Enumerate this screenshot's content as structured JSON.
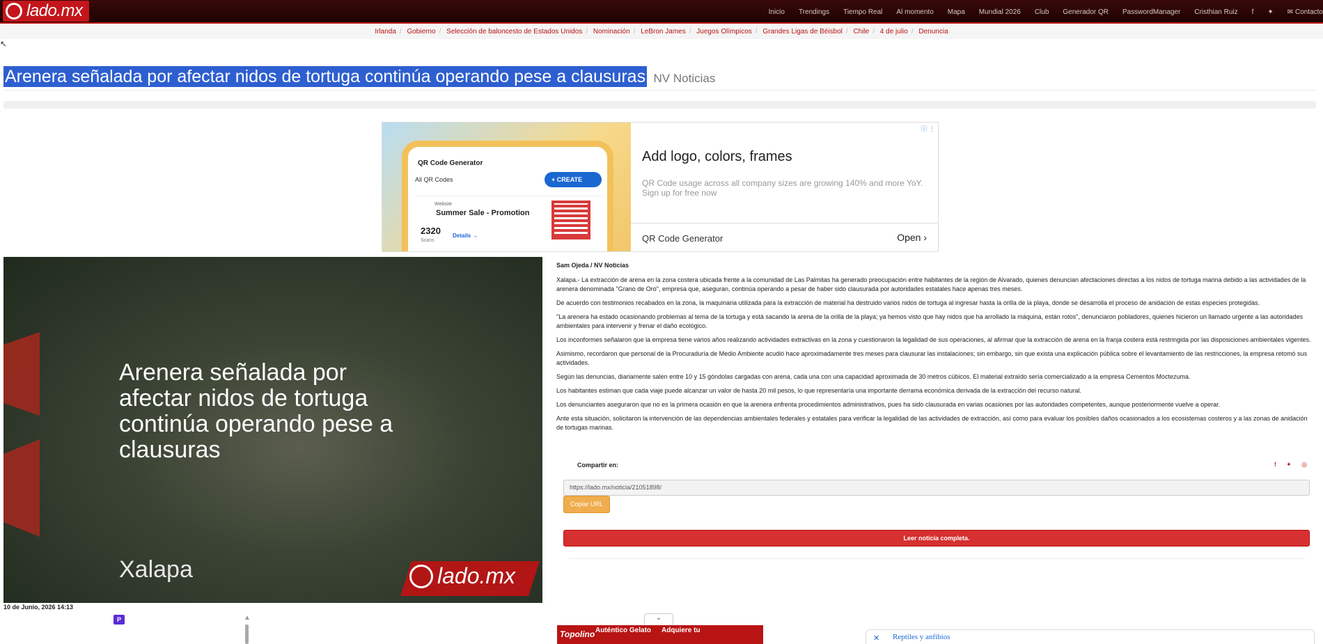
{
  "brand": {
    "logo_text": "lado.mx"
  },
  "nav": {
    "links": [
      "Inicio",
      "Trendings",
      "Tiempo Real",
      "Al momento",
      "Mapa",
      "Mundial 2026",
      "Club",
      "Generador QR",
      "PasswordManager",
      "Cristhian Ruiz"
    ],
    "contact_label": "Contacto"
  },
  "tags": [
    "Irlanda",
    "Gobierno",
    "Selección de baloncesto de Estados Unidos",
    "Nominación",
    "LeBron James",
    "Juegos Olímpicos",
    "Grandes Ligas de Béisbol",
    "Chile",
    "4 de julio",
    "Denuncia"
  ],
  "article": {
    "title": "Arenera señalada por afectar nidos de tortuga continúa operando pese a clausuras",
    "source": "NV Noticias",
    "author": "Sam Ojeda / NV Noticias",
    "date": "10 de Junio, 2026 14:13",
    "paragraphs": [
      "Xalapa.- La extracción de arena en la zona costera ubicada frente a la comunidad de Las Palmitas ha generado preocupación entre habitantes de la región de Alvarado, quienes denuncian afectaciones directas a los nidos de tortuga marina debido a las actividades de la arenera denominada \"Grano de Oro\", empresa que, aseguran, continúa operando a pesar de haber sido clausurada por autoridades estatales hace apenas tres meses.",
      "De acuerdo con testimonios recabados en la zona, la maquinaria utilizada para la extracción de material ha destruido varios nidos de tortuga al ingresar hasta la orilla de la playa, donde se desarrolla el proceso de anidación de estas especies protegidas.",
      "\"La arenera ha estado ocasionando problemas al tema de la tortuga y está sacando la arena de la orilla de la playa; ya hemos visto que hay nidos que ha arrollado la máquina, están rotos\", denunciaron pobladores, quienes hicieron un llamado urgente a las autoridades ambientales para intervenir y frenar el daño ecológico.",
      "Los inconformes señalaron que la empresa tiene varios años realizando actividades extractivas en la zona y cuestionaron la legalidad de sus operaciones, al afirmar que la extracción de arena en la franja costera está restringida por las disposiciones ambientales vigentes.",
      "Asimismo, recordaron que personal de la Procuraduría de Medio Ambiente  acudió hace aproximadamente tres meses para clausurar las instalaciones; sin embargo, sin que exista una explicación pública sobre el levantamiento de las restricciones, la empresa retomó sus actividades.",
      "Según las denuncias, diariamente salen entre 10 y 15 góndolas cargadas con arena, cada una con una capacidad aproximada de 30 metros cúbicos. El material extraído sería comercializado a la empresa Cementos Moctezuma.",
      "Los habitantes estiman que cada viaje puede alcanzar un valor de hasta 20 mil pesos, lo que representaría una importante derrama económica derivada de la extracción del recurso natural.",
      "Los denunciantes aseguraron que no es la primera ocasión en que la arenera enfrenta procedimientos administrativos, pues ha sido clausurada en varias ocasiones por las autoridades competentes, aunque posteriormente vuelve a operar.",
      "Ante esta situación, solicitaron la intervención de las dependencias ambientales federales y estatales para verificar la legalidad de las actividades de extracción, así como para evaluar los posibles daños ocasionados a los ecosistemas costeros y a las zonas de anidación de tortugas marinas."
    ]
  },
  "hero": {
    "title": "Arenera señalada por afectar nidos de tortuga continúa operando pese a clausuras",
    "city": "Xalapa",
    "logo_text": "lado.mx"
  },
  "ad": {
    "app_name": "QR Code Generator",
    "all_codes": "All QR Codes",
    "create_label": "+ CREATE",
    "card_type": "Website",
    "card_title": "Summer Sale - Promotion",
    "card_number": "2320",
    "card_scans": "Scans",
    "card_details": "Details →",
    "headline": "Add logo, colors, frames",
    "description": "QR Code usage across all company sizes are growing 140% and more YoY. Sign up for free now",
    "brand": "QR Code Generator",
    "cta": "Open ›",
    "info_icon": "ⓘ ⋮"
  },
  "share": {
    "label": "Compartir en:",
    "icons": "f ✦ ◎",
    "url": "https://lado.mx/noticia/21051898/",
    "copy_label": "Copiar URL",
    "read_label": "Leer noticia completa."
  },
  "bottom": {
    "ad_brand": "Topolino",
    "ad_text1": "Auténtico Gelato",
    "ad_text2": "Adquiere tu",
    "collapse_icon": "⌄",
    "related_label": "Reptiles y anfibios",
    "close_icon": "✕",
    "small_icon": "P"
  },
  "colors": {
    "brand_red": "#b81414",
    "nav_bg": "#1d0202",
    "selection_blue": "#2e5fd0",
    "copy_orange": "#f0ad4e"
  }
}
